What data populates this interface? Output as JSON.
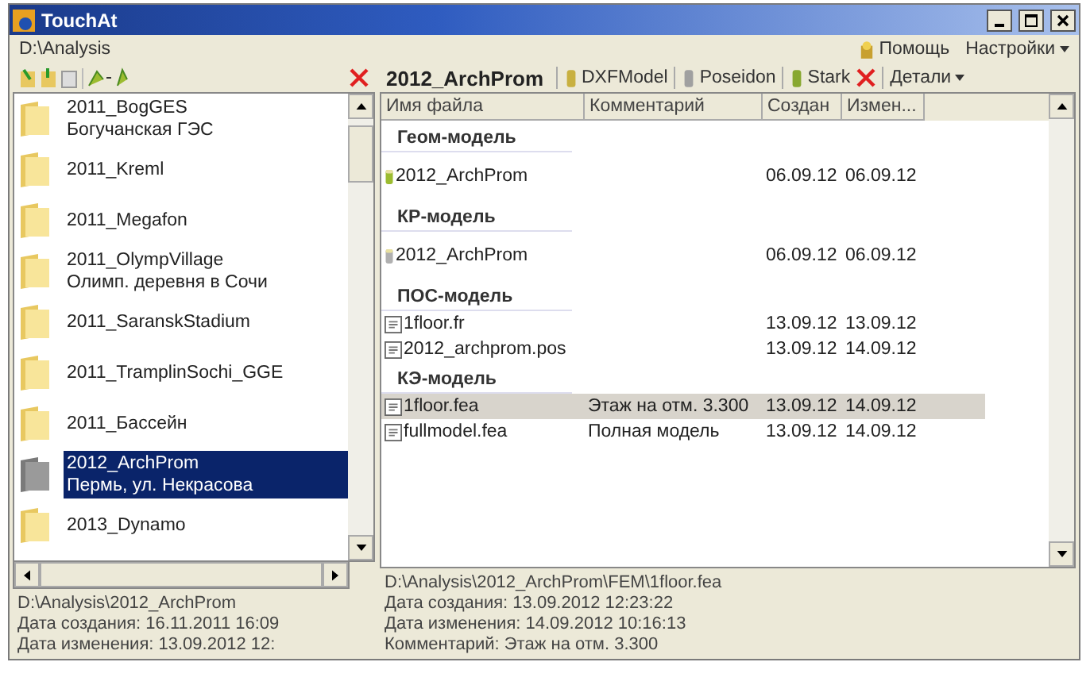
{
  "window": {
    "title": "TouchAt"
  },
  "menu_bar": {
    "path": "D:\\Analysis",
    "help": "Помощь",
    "settings": "Настройки"
  },
  "folders": [
    {
      "name": "2011_BogGES",
      "subtitle": "Богучанская ГЭС",
      "selected": false
    },
    {
      "name": "2011_Kreml",
      "selected": false
    },
    {
      "name": "2011_Megafon",
      "selected": false
    },
    {
      "name": "2011_OlympVillage",
      "subtitle": "Олимп. деревня в Сочи",
      "selected": false
    },
    {
      "name": "2011_SaranskStadium",
      "selected": false
    },
    {
      "name": "2011_TramplinSochi_GGE",
      "selected": false
    },
    {
      "name": "2011_Бассейн",
      "selected": false
    },
    {
      "name": "2012_ArchProm",
      "subtitle": "Пермь, ул. Некрасова",
      "selected": true
    },
    {
      "name": "2013_Dynamo",
      "selected": false
    }
  ],
  "left_status": [
    "D:\\Analysis\\2012_ArchProm",
    "Дата создания: 16.11.2011 16:09",
    "Дата изменения: 13.09.2012 12:"
  ],
  "project": {
    "title": "2012_ArchProm",
    "tools": [
      "DXFModel",
      "Poseidon",
      "Stark"
    ],
    "details": "Детали"
  },
  "columns": [
    "Имя файла",
    "Комментарий",
    "Создан",
    "Измен..."
  ],
  "groups": [
    {
      "title": "Геом-модель",
      "files": [
        {
          "kind": "model",
          "name": "2012_ArchProm",
          "created": "06.09.12",
          "modified": "06.09.12",
          "selected": false
        }
      ]
    },
    {
      "title": "КР-модель",
      "files": [
        {
          "kind": "model-inactive",
          "name": "2012_ArchProm",
          "created": "06.09.12",
          "modified": "06.09.12",
          "selected": false
        }
      ]
    },
    {
      "title": "ПОС-модель",
      "files": [
        {
          "kind": "text",
          "name": "1floor.fr",
          "created": "13.09.12",
          "modified": "13.09.12",
          "selected": false
        },
        {
          "kind": "text",
          "name": "2012_archprom.pos",
          "created": "13.09.12",
          "modified": "14.09.12",
          "selected": false
        }
      ]
    },
    {
      "title": "КЭ-модель",
      "files": [
        {
          "kind": "text",
          "name": "1floor.fea",
          "comment": "Этаж на отм. 3.300",
          "created": "13.09.12",
          "modified": "14.09.12",
          "selected": true
        },
        {
          "kind": "text",
          "name": "fullmodel.fea",
          "comment": "Полная модель",
          "created": "13.09.12",
          "modified": "14.09.12",
          "selected": false
        }
      ]
    }
  ],
  "right_status": [
    "D:\\Analysis\\2012_ArchProm\\FEM\\1floor.fea",
    "Дата создания: 13.09.2012 12:23:22",
    "Дата изменения: 14.09.2012 10:16:13",
    "Комментарий: Этаж на отм. 3.300"
  ]
}
